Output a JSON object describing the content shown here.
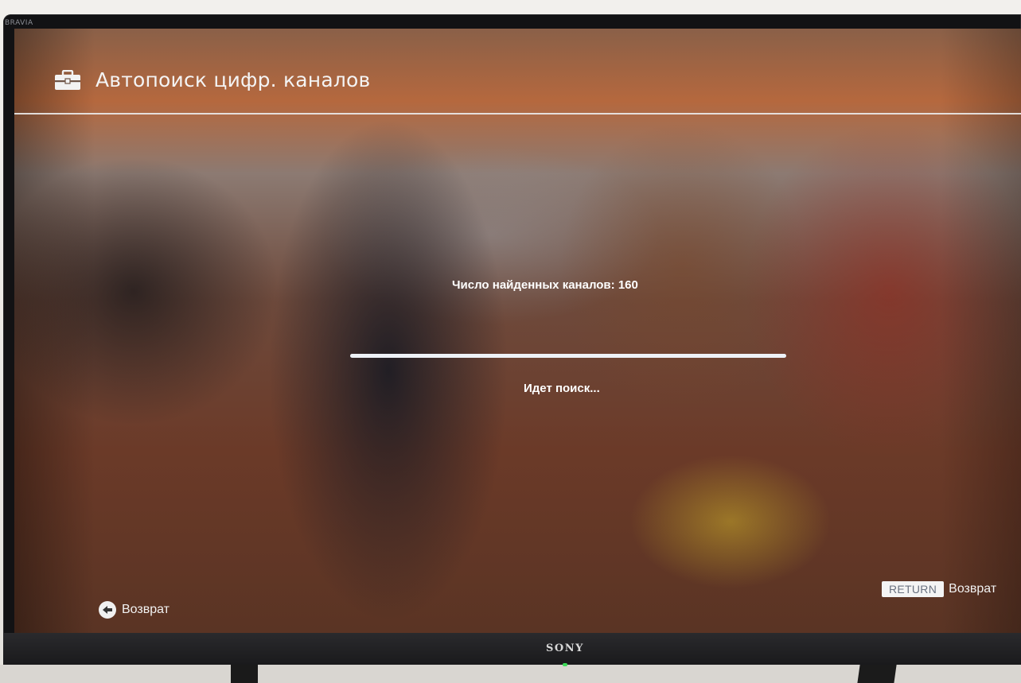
{
  "bezel": {
    "corner_brand": "BRAVIA",
    "logo": "SONY"
  },
  "header": {
    "icon": "toolbox-icon",
    "title": "Автопоиск цифр. каналов"
  },
  "scan": {
    "found_label": "Число найденных каналов:",
    "found_count": "160",
    "progress_fraction": 1.0,
    "status": "Идет поиск..."
  },
  "footer": {
    "back_left_icon": "back-arrow-icon",
    "back_left_label": "Возврат",
    "return_key": "RETURN",
    "return_label": "Возврат"
  },
  "colors": {
    "text": "#ffffff",
    "progress": "#eef2f7",
    "power_led": "#3ddc58"
  }
}
